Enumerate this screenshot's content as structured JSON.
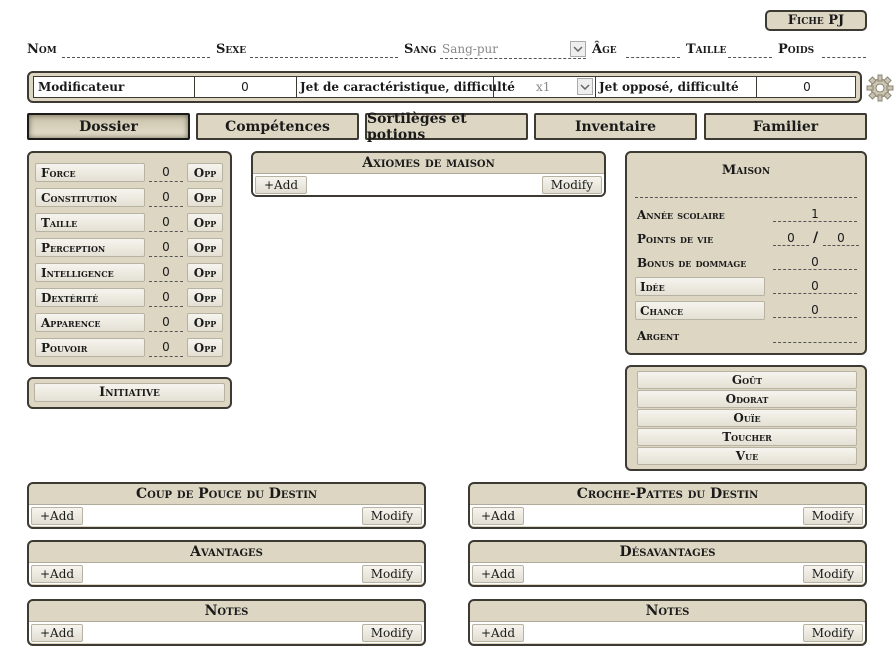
{
  "header": {
    "fiche_button": "Fiche PJ",
    "nom_label": "Nom",
    "sexe_label": "Sexe",
    "sang_label": "Sang",
    "sang_value": "Sang-pur",
    "age_label": "Âge",
    "taille_label": "Taille",
    "poids_label": "Poids"
  },
  "modbar": {
    "modificateur_label": "Modificateur",
    "modificateur_value": "0",
    "jet_label": "Jet de caractéristique, difficulté",
    "jet_value": "x1",
    "oppose_label": "Jet opposé, difficulté",
    "oppose_value": "0"
  },
  "tabs": [
    {
      "label": "Dossier",
      "active": true
    },
    {
      "label": "Compétences"
    },
    {
      "label": "Sortilèges et potions"
    },
    {
      "label": "Inventaire"
    },
    {
      "label": "Familier"
    }
  ],
  "characteristics": [
    {
      "name": "Force",
      "value": "0",
      "opp": "Opp"
    },
    {
      "name": "Constitution",
      "value": "0",
      "opp": "Opp"
    },
    {
      "name": "Taille",
      "value": "0",
      "opp": "Opp"
    },
    {
      "name": "Perception",
      "value": "0",
      "opp": "Opp"
    },
    {
      "name": "Intelligence",
      "value": "0",
      "opp": "Opp"
    },
    {
      "name": "Dextérité",
      "value": "0",
      "opp": "Opp"
    },
    {
      "name": "Apparence",
      "value": "0",
      "opp": "Opp"
    },
    {
      "name": "Pouvoir",
      "value": "0",
      "opp": "Opp"
    }
  ],
  "initiative": "Initiative",
  "axiomes": {
    "title": "Axiomes de maison",
    "add": "+Add",
    "modify": "Modify"
  },
  "maison": {
    "title": "Maison",
    "annee_label": "Année scolaire",
    "annee_value": "1",
    "pv_label": "Points de vie",
    "pv_current": "0",
    "pv_sep": "/",
    "pv_max": "0",
    "bonus_label": "Bonus de dommage",
    "bonus_value": "0",
    "idee_label": "Idée",
    "idee_value": "0",
    "chance_label": "Chance",
    "chance_value": "0",
    "argent_label": "Argent"
  },
  "senses": [
    "Goût",
    "Odorat",
    "Ouïe",
    "Toucher",
    "Vue"
  ],
  "sections": {
    "coup_de_pouce": {
      "title": "Coup de Pouce du Destin",
      "add": "+Add",
      "modify": "Modify"
    },
    "croche_pattes": {
      "title": "Croche-Pattes du Destin",
      "add": "+Add",
      "modify": "Modify"
    },
    "avantages": {
      "title": "Avantages",
      "add": "+Add",
      "modify": "Modify"
    },
    "desavantages": {
      "title": "Désavantages",
      "add": "+Add",
      "modify": "Modify"
    },
    "notes_left": {
      "title": "Notes",
      "add": "+Add",
      "modify": "Modify"
    },
    "notes_right": {
      "title": "Notes",
      "add": "+Add",
      "modify": "Modify"
    }
  },
  "colors": {
    "panel": "#dcd6c3",
    "border": "#3d3a33",
    "field": "#ffffff"
  },
  "icons": {
    "settings": "gear-icon",
    "dropdown": "chevron-down-icon"
  }
}
